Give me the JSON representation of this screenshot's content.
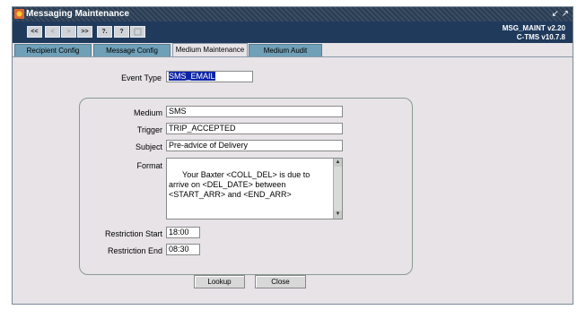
{
  "window": {
    "title": "Messaging Maintenance",
    "version_line1": "MSG_MAINT v2.20",
    "version_line2": "C-TMS v10.7.8"
  },
  "toolbar": {
    "first": "<<",
    "prev": "<",
    "next": ">",
    "last": ">>",
    "help_query": "?.",
    "help": "?"
  },
  "tabs": [
    {
      "label": "Recipient Config"
    },
    {
      "label": "Message Config"
    },
    {
      "label": "Medium Maintenance",
      "active": true
    },
    {
      "label": "Medium Audit"
    }
  ],
  "form": {
    "event_type_label": "Event Type",
    "event_type_value": "SMS_EMAIL",
    "medium_label": "Medium",
    "medium_value": "SMS",
    "trigger_label": "Trigger",
    "trigger_value": "TRIP_ACCEPTED",
    "subject_label": "Subject",
    "subject_value": "Pre-advice of Delivery",
    "format_label": "Format",
    "format_value": "Your Baxter <COLL_DEL> is due to arrive on <DEL_DATE> between <START_ARR> and <END_ARR>",
    "restriction_start_label": "Restriction Start",
    "restriction_start_value": "18:00",
    "restriction_end_label": "Restriction End",
    "restriction_end_value": "08:30"
  },
  "buttons": {
    "lookup": "Lookup",
    "close": "Close"
  }
}
